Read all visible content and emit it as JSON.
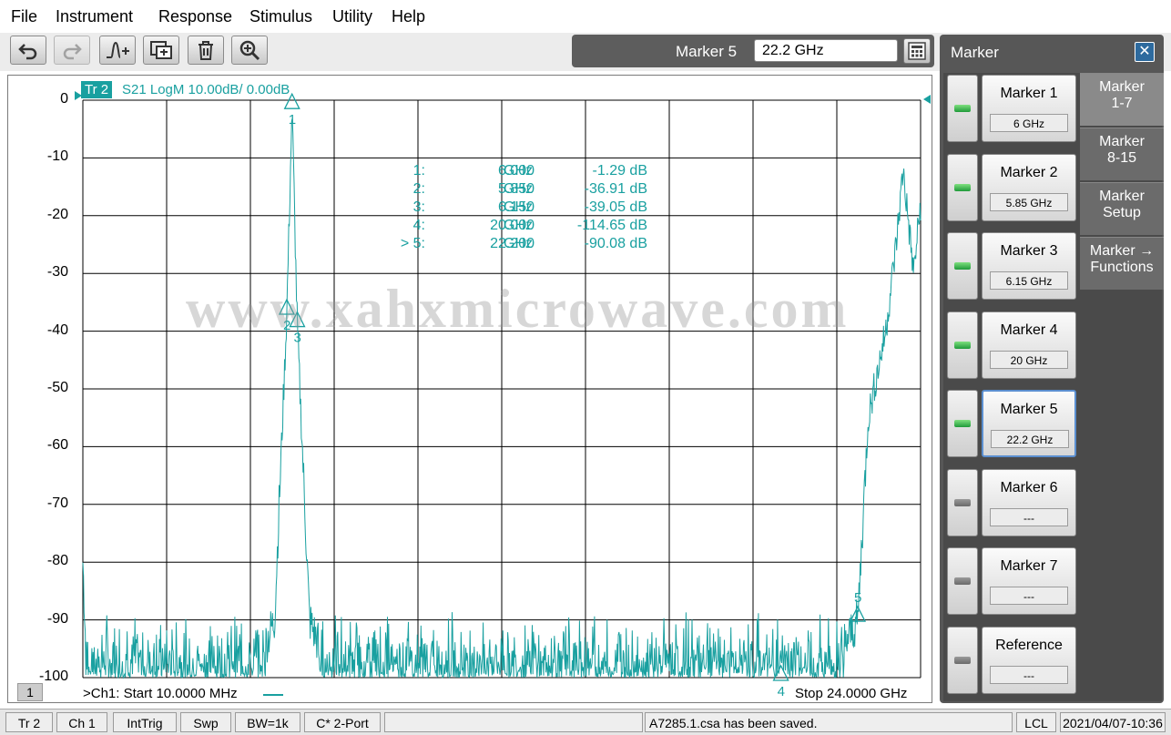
{
  "menu": [
    "File",
    "Instrument",
    "Response",
    "Stimulus",
    "Utility",
    "Help"
  ],
  "toolbar": {
    "buttons": [
      {
        "name": "undo-button",
        "icon": "undo-icon"
      },
      {
        "name": "redo-button",
        "icon": "redo-icon"
      },
      {
        "name": "add-marker-button",
        "icon": "marker-plus-icon"
      },
      {
        "name": "copy-channel-button",
        "icon": "copy-icon"
      },
      {
        "name": "delete-button",
        "icon": "trash-icon"
      },
      {
        "name": "zoom-button",
        "icon": "zoom-in-icon"
      }
    ],
    "entry_label": "Marker 5",
    "entry_value": "22.2 GHz"
  },
  "trace": {
    "tag": "Tr 2",
    "info": "S21 LogM 10.00dB/  0.00dB",
    "color": "#19a0a0"
  },
  "axis": {
    "y_ticks": [
      "0",
      "-10",
      "-20",
      "-30",
      "-40",
      "-50",
      "-60",
      "-70",
      "-80",
      "-90",
      "-100"
    ],
    "start": ">Ch1:  Start   10.0000 MHz",
    "stop": "Stop  24.0000 GHz",
    "channel_num": "1"
  },
  "markers": [
    {
      "idx": "1:",
      "freq": "6.000",
      "unit": "GHz",
      "value": "-1.29 dB"
    },
    {
      "idx": "2:",
      "freq": "5.850",
      "unit": "GHz",
      "value": "-36.91 dB"
    },
    {
      "idx": "3:",
      "freq": "6.150",
      "unit": "GHz",
      "value": "-39.05 dB"
    },
    {
      "idx": "4:",
      "freq": "20.000",
      "unit": "GHz",
      "value": "-114.65 dB"
    },
    {
      "idx": "> 5:",
      "freq": "22.200",
      "unit": "GHz",
      "value": "-90.08 dB"
    }
  ],
  "chart_data": {
    "type": "line",
    "title": "S21 LogM 10.00dB/  0.00dB",
    "xlim_ghz": [
      0.01,
      24.0
    ],
    "ylim": [
      -100,
      0
    ],
    "grid": true,
    "series": [
      {
        "name": "Tr 2",
        "x_ghz": [
          0.01,
          0.1,
          1.0,
          3.0,
          5.0,
          5.5,
          5.85,
          6.0,
          6.15,
          6.5,
          7.0,
          10.0,
          15.0,
          19.0,
          20.0,
          21.5,
          22.2,
          22.5,
          23.0,
          23.3,
          23.5,
          23.6,
          23.8,
          24.0
        ],
        "y_db": [
          -80,
          -95,
          -98,
          -98,
          -98,
          -90,
          -36.91,
          -1.29,
          -39.05,
          -90,
          -98,
          -98,
          -97,
          -96,
          -100,
          -98,
          -90.08,
          -55,
          -40,
          -25,
          -12,
          -18,
          -30,
          -18
        ]
      }
    ],
    "marker_points": [
      {
        "label": "1",
        "x_ghz": 6.0,
        "y_db": -1.29
      },
      {
        "label": "2",
        "x_ghz": 5.85,
        "y_db": -36.91
      },
      {
        "label": "3",
        "x_ghz": 6.15,
        "y_db": -39.05
      },
      {
        "label": "4",
        "x_ghz": 20.0,
        "y_db": -114.65
      },
      {
        "label": "5",
        "x_ghz": 22.2,
        "y_db": -90.08
      }
    ]
  },
  "watermark": "www.xahxmicrowave.com",
  "side_panel": {
    "title": "Marker",
    "softkeys": [
      {
        "label": "Marker 1",
        "value": "6 GHz",
        "on": true
      },
      {
        "label": "Marker 2",
        "value": "5.85 GHz",
        "on": true
      },
      {
        "label": "Marker 3",
        "value": "6.15 GHz",
        "on": true
      },
      {
        "label": "Marker 4",
        "value": "20 GHz",
        "on": true
      },
      {
        "label": "Marker 5",
        "value": "22.2 GHz",
        "on": true
      },
      {
        "label": "Marker 6",
        "value": "---",
        "on": false
      },
      {
        "label": "Marker 7",
        "value": "---",
        "on": false
      },
      {
        "label": "Reference",
        "value": "---",
        "on": false
      }
    ],
    "tabs": [
      {
        "line1": "Marker",
        "line2": "1-7"
      },
      {
        "line1": "Marker",
        "line2": "8-15"
      },
      {
        "line1": "Marker",
        "line2": "Setup"
      },
      {
        "line1": "Marker →",
        "line2": "Functions"
      }
    ]
  },
  "status": [
    "Tr 2",
    "Ch 1",
    "IntTrig",
    "Swp",
    "BW=1k",
    "C* 2-Port",
    "",
    "A7285.1.csa has been saved.",
    "LCL",
    "2021/04/07-10:36"
  ]
}
